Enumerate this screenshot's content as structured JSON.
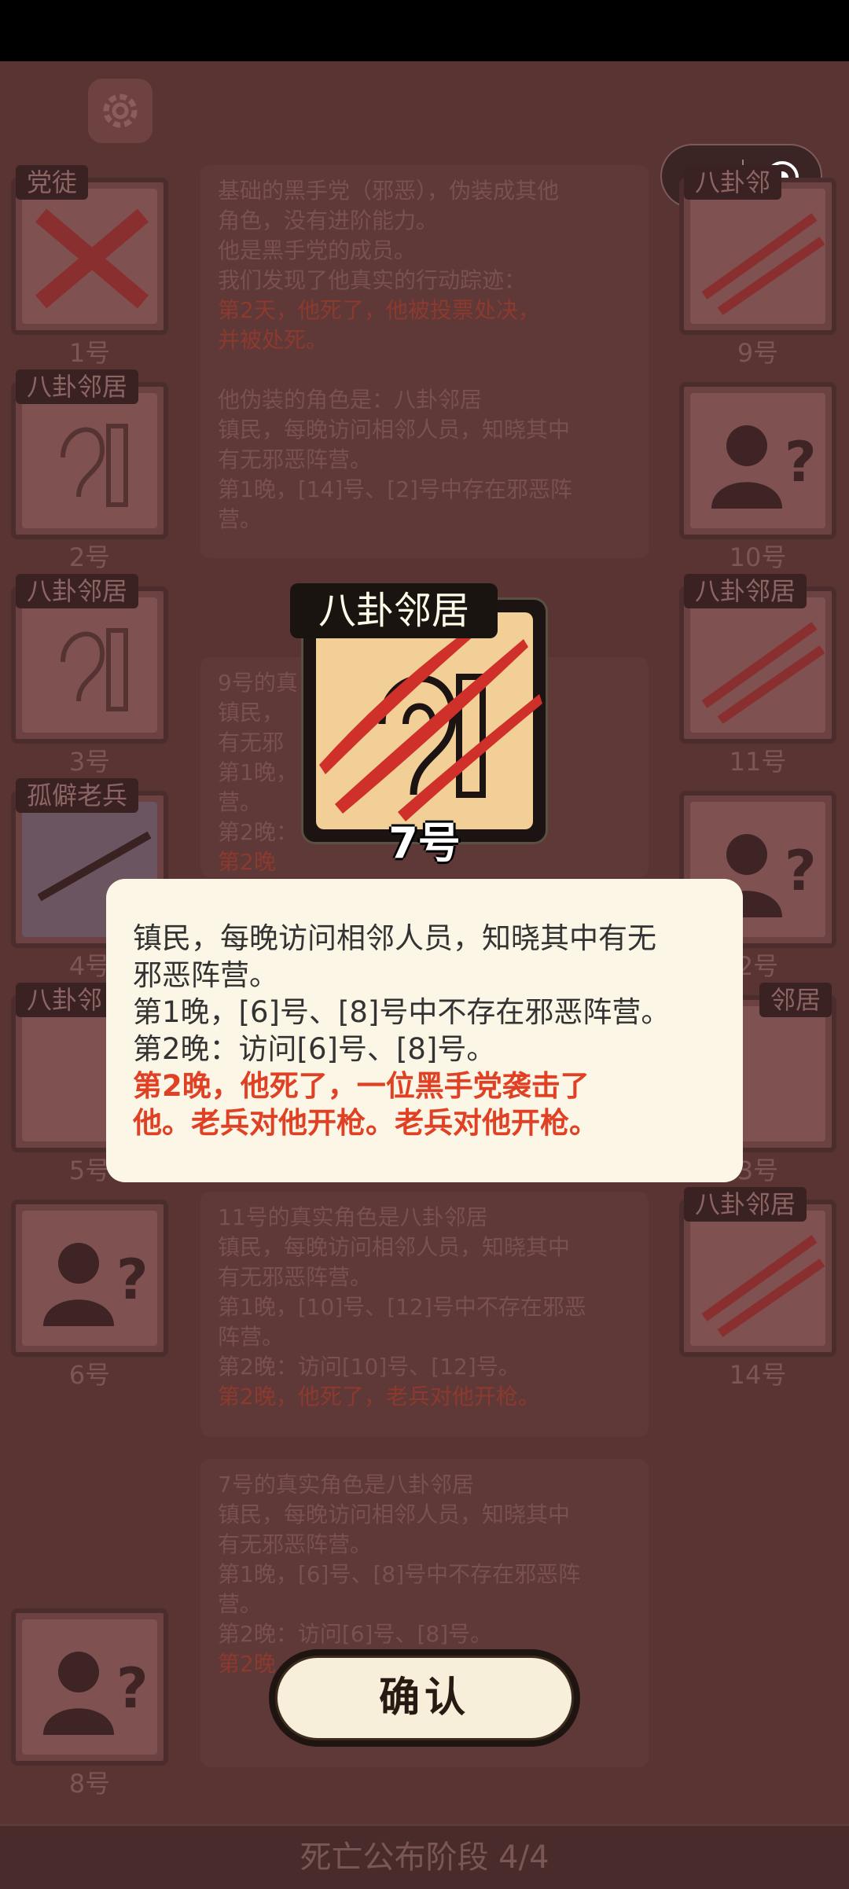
{
  "colors": {
    "board_bg": "#5a3333",
    "dialog_bg": "#fbf6e6",
    "card_face": "#f2cf97",
    "claw_red": "#d0302a",
    "highlight_red": "#e04024"
  },
  "topbar": {
    "settings_icon": "gear-icon",
    "menu_icon": "more-dots-icon",
    "close_icon": "target-circle-icon"
  },
  "players": [
    {
      "tag": "党徒",
      "num": "1号"
    },
    {
      "tag": "八卦邻居",
      "num": "2号"
    },
    {
      "tag": "八卦邻居",
      "num": "3号"
    },
    {
      "tag": "孤僻老兵",
      "num": "4号"
    },
    {
      "tag": "八卦邻",
      "num": "5号"
    },
    {
      "tag": "",
      "num": "6号"
    },
    {
      "tag": "",
      "num": "8号"
    },
    {
      "tag": "八卦邻",
      "num": "9号"
    },
    {
      "tag": "",
      "num": "10号"
    },
    {
      "tag": "八卦邻居",
      "num": "11号"
    },
    {
      "tag": "",
      "num": "2号"
    },
    {
      "tag": "邻居",
      "num": "3号"
    },
    {
      "tag": "八卦邻居",
      "num": "14号"
    }
  ],
  "logs": [
    {
      "lines": [
        "基础的黑手党（邪恶），伪装成其他",
        "角色，没有进阶能力。",
        "他是黑手党的成员。",
        "我们发现了他真实的行动踪迹："
      ],
      "red": [
        "第2天，他死了，他被投票处决，",
        "并被处死。"
      ],
      "extra": [
        "",
        "他伪装的角色是：八卦邻居",
        "镇民，每晚访问相邻人员，知晓其中",
        "有无邪恶阵营。",
        "第1晚，[14]号、[2]号中存在邪恶阵",
        "营。"
      ]
    },
    {
      "lines": [
        "9号的真",
        "镇民，",
        "有无邪",
        "第1晚，",
        "营。",
        "第2晚："
      ],
      "red": [
        "第2晚"
      ],
      "extra": []
    },
    {
      "lines": [
        "11号的真实角色是八卦邻居",
        "镇民，每晚访问相邻人员，知晓其中",
        "有无邪恶阵营。",
        "第1晚，[10]号、[12]号中不存在邪恶",
        "阵营。",
        "第2晚：访问[10]号、[12]号。"
      ],
      "red": [
        "第2晚，他死了，老兵对他开枪。"
      ],
      "extra": []
    },
    {
      "lines": [
        "7号的真实角色是八卦邻居",
        "镇民，每晚访问相邻人员，知晓其中",
        "有无邪恶阵营。",
        "第1晚，[6]号、[8]号中不存在邪恶阵",
        "营。",
        "第2晚：访问[6]号、[8]号。"
      ],
      "red": [
        "第2晚"
      ],
      "extra": []
    }
  ],
  "focus": {
    "tag": "八卦邻居",
    "num": "7号",
    "icon": "ear-speaker-icon",
    "overlay": "claw-marks-icon"
  },
  "dialog": {
    "line1": "镇民，每晚访问相邻人员，知晓其中有无",
    "line2": "邪恶阵营。",
    "line3": "第1晚，[6]号、[8]号中不存在邪恶阵营。",
    "line4": "第2晚：访问[6]号、[8]号。",
    "red1": "第2晚，他死了，一位黑手党袭击了",
    "red2": "他。老兵对他开枪。老兵对他开枪。"
  },
  "confirm_label": "确认",
  "phase_label": "死亡公布阶段 4/4"
}
